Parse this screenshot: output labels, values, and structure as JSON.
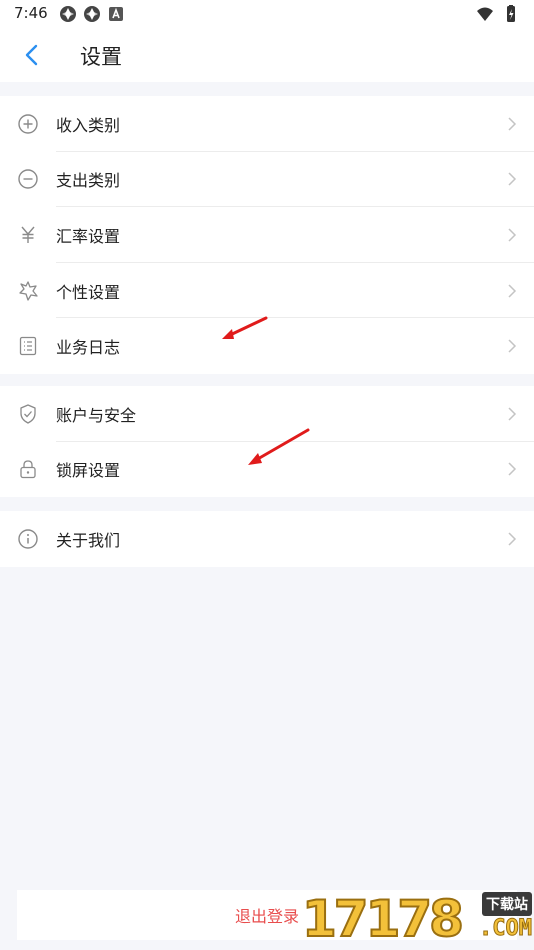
{
  "status_bar": {
    "time": "7:46",
    "left_icons": [
      "app-notification-icon",
      "app-notification-icon",
      "a-notification-icon"
    ],
    "right_icons": [
      "wifi-icon",
      "battery-icon"
    ]
  },
  "header": {
    "back_icon": "chevron-left-icon",
    "title": "设置"
  },
  "groups": [
    {
      "items": [
        {
          "label": "收入类别",
          "icon": "plus-circle-icon"
        },
        {
          "label": "支出类别",
          "icon": "minus-circle-icon"
        },
        {
          "label": "汇率设置",
          "icon": "yen-icon"
        },
        {
          "label": "个性设置",
          "icon": "sparkle-badge-icon"
        },
        {
          "label": "业务日志",
          "icon": "list-document-icon"
        }
      ]
    },
    {
      "items": [
        {
          "label": "账户与安全",
          "icon": "shield-check-icon"
        },
        {
          "label": "锁屏设置",
          "icon": "lock-icon"
        }
      ]
    },
    {
      "items": [
        {
          "label": "关于我们",
          "icon": "info-circle-icon"
        }
      ]
    }
  ],
  "logout": {
    "label": "退出登录"
  },
  "watermark": {
    "digits": "17178",
    "badge": "下载站",
    "suffix": ".COM"
  },
  "colors": {
    "accent": "#2b8ff0",
    "danger": "#e84d4d",
    "background": "#f5f6fa",
    "annotation_arrow": "#e01b1b"
  }
}
